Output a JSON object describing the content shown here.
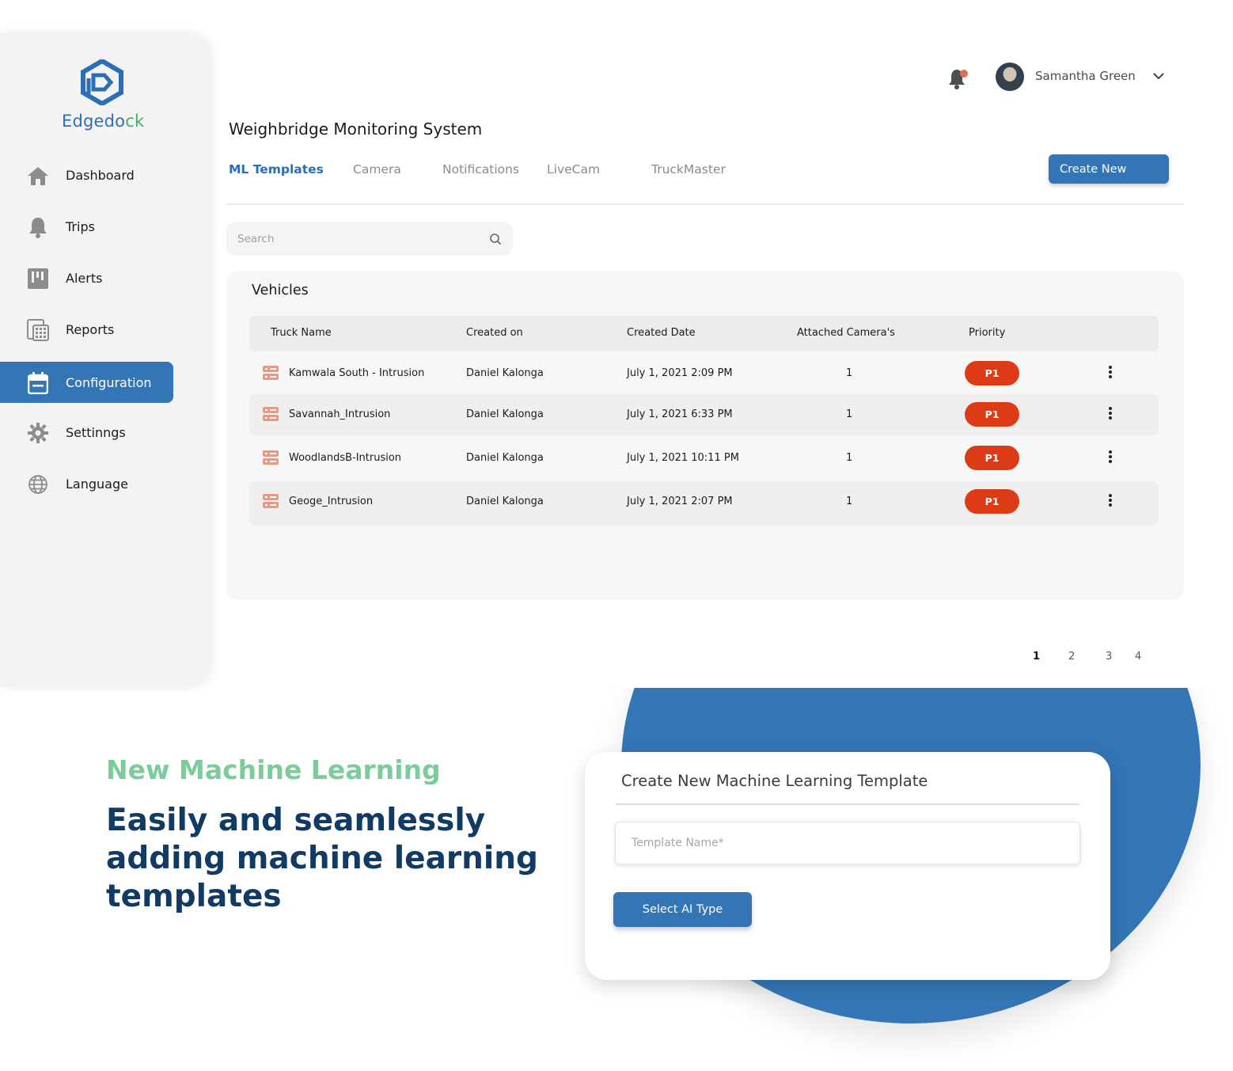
{
  "brand": {
    "name_part1": "Edge",
    "name_part2": "dock",
    "name_part3": "ck",
    "logo_icon": "edgedock-logo-icon"
  },
  "sidebar": {
    "items": [
      {
        "label": "Dashboard",
        "icon": "home-icon"
      },
      {
        "label": "Trips",
        "icon": "bell-icon"
      },
      {
        "label": "Alerts",
        "icon": "kanban-icon"
      },
      {
        "label": "Reports",
        "icon": "calculator-icon"
      },
      {
        "label": "Configuration",
        "icon": "calendar-icon",
        "active": true
      },
      {
        "label": "Settinngs",
        "icon": "gear-icon"
      },
      {
        "label": "Language",
        "icon": "globe-icon"
      }
    ]
  },
  "header": {
    "user_name": "Samantha Green",
    "notification_icon": "bell-icon",
    "has_unread": true
  },
  "page": {
    "title": "Weighbridge Monitoring System",
    "tabs": [
      "ML Templates",
      "Camera",
      "Notifications",
      "LiveCam",
      "TruckMaster"
    ],
    "active_tab": "ML Templates",
    "create_label": "Create New",
    "search_placeholder": "Search"
  },
  "table": {
    "title": "Vehicles",
    "columns": [
      "Truck Name",
      "Created on",
      "Created Date",
      "Attached Camera's",
      "Priority"
    ],
    "rows": [
      {
        "name": "Kamwala South - Intrusion",
        "created_by": "Daniel Kalonga",
        "date": "July 1, 2021 2:09 PM",
        "cameras": "1",
        "priority": "P1"
      },
      {
        "name": "Savannah_Intrusion",
        "created_by": "Daniel Kalonga",
        "date": "July 1, 2021 6:33 PM",
        "cameras": "1",
        "priority": "P1"
      },
      {
        "name": "WoodlandsB-Intrusion",
        "created_by": "Daniel Kalonga",
        "date": "July 1, 2021 10:11 PM",
        "cameras": "1",
        "priority": "P1"
      },
      {
        "name": "Geoge_Intrusion",
        "created_by": "Daniel Kalonga",
        "date": "July 1, 2021 2:07 PM",
        "cameras": "1",
        "priority": "P1"
      }
    ]
  },
  "pagination": {
    "pages": [
      "1",
      "2",
      "3",
      "4"
    ],
    "current": "1"
  },
  "promo": {
    "eyebrow": "New Machine Learning",
    "headline": "Easily and seamlessly adding machine learning templates"
  },
  "modal": {
    "title": "Create New Machine Learning Template",
    "template_placeholder": "Template Name*",
    "select_label": "Select AI Type"
  },
  "colors": {
    "primary": "#3476b5",
    "priority": "#dd3b15",
    "accent_green": "#7ccc9b",
    "headline": "#123b63"
  }
}
